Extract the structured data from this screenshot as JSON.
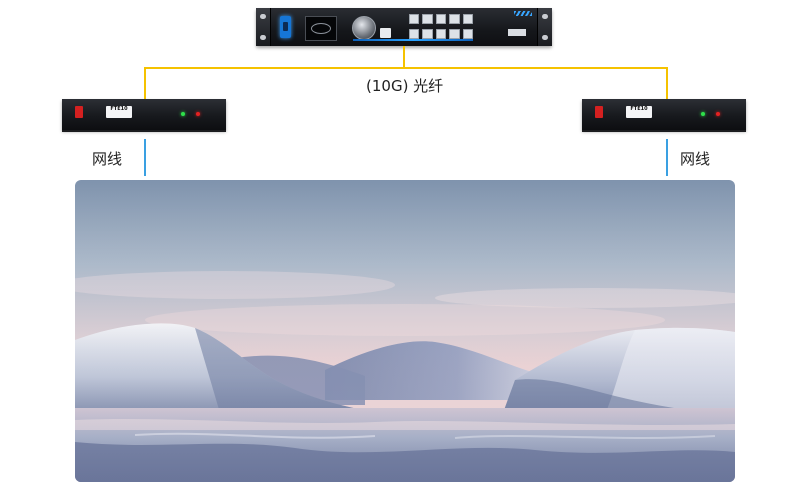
{
  "connection_labels": {
    "fiber": "(10G) 光纤",
    "left_cable": "网线",
    "right_cable": "网线"
  },
  "devices": {
    "controller": {
      "icon": "video-controller-icon"
    },
    "left_converter": {
      "badge": "FTE10",
      "icon": "fiber-converter-icon"
    },
    "right_converter": {
      "badge": "FTE10",
      "icon": "fiber-converter-icon"
    }
  },
  "colors": {
    "fiber_line": "#f5c200",
    "network_line": "#3aa0e2"
  }
}
